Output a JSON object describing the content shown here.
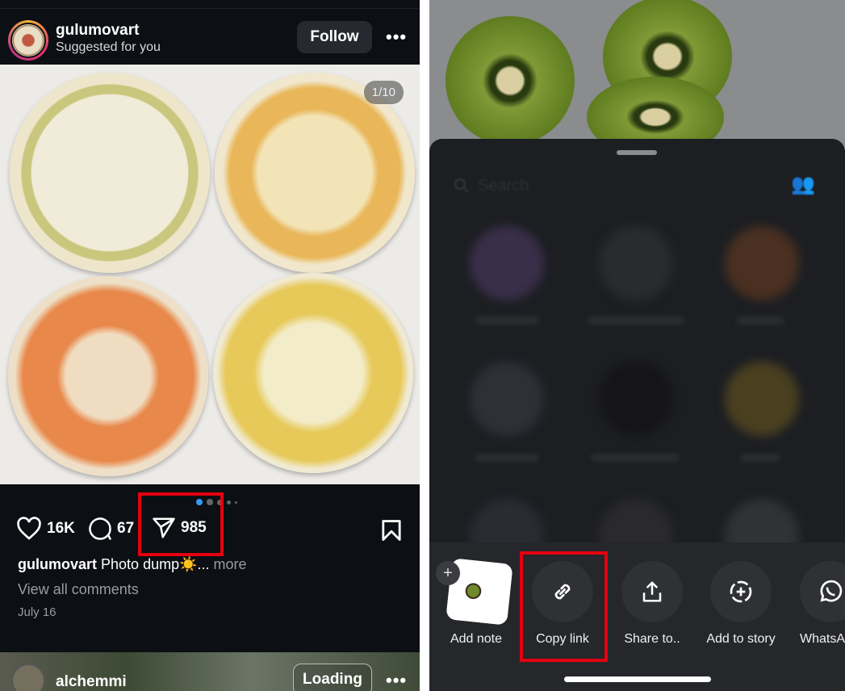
{
  "left": {
    "post": {
      "username": "gulumovart",
      "subtitle": "Suggested for you",
      "follow_label": "Follow",
      "image_counter": "1/10",
      "likes": "16K",
      "comments": "67",
      "shares": "985",
      "caption_user": "gulumovart",
      "caption_text": "Photo dump☀️...",
      "more_label": "more",
      "view_comments": "View all comments",
      "date": "July 16"
    },
    "next_post": {
      "username": "alchemmi",
      "button_label": "Loading"
    },
    "highlight_color": "#e5000f"
  },
  "right": {
    "search_placeholder": "Search",
    "actions": [
      {
        "label": "Add note",
        "icon": "add-note-thumbnail"
      },
      {
        "label": "Copy link",
        "icon": "link-icon"
      },
      {
        "label": "Share to..",
        "icon": "share-icon"
      },
      {
        "label": "Add to story",
        "icon": "add-story-icon"
      },
      {
        "label": "WhatsA",
        "icon": "whatsapp-icon"
      }
    ]
  }
}
